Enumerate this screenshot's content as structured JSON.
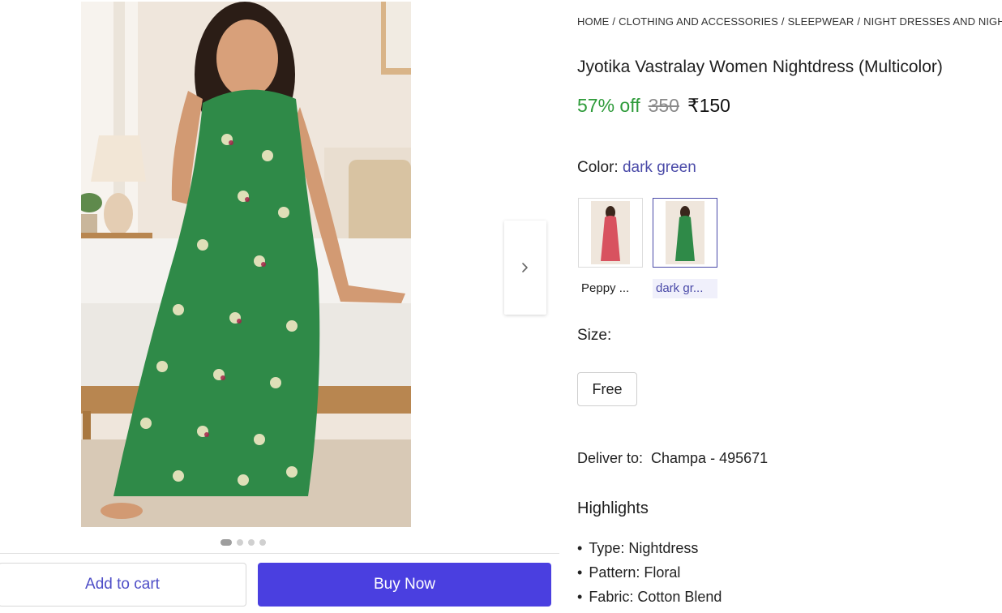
{
  "breadcrumb": [
    "HOME",
    "CLOTHING AND ACCESSORIES",
    "SLEEPWEAR",
    "NIGHT DRESSES AND NIGHTIES"
  ],
  "product": {
    "title": "Jyotika Vastralay Women Nightdress (Multicolor)",
    "discount": "57% off",
    "mrp": "350",
    "price": "₹150"
  },
  "color": {
    "label": "Color:",
    "selected": "dark green",
    "options": [
      {
        "label": "Peppy ...",
        "swatch": "#d8525f"
      },
      {
        "label": "dark gr...",
        "swatch": "#2f8a48"
      }
    ]
  },
  "size": {
    "label": "Size:",
    "options": [
      "Free"
    ]
  },
  "delivery": {
    "label": "Deliver to:",
    "location": "Champa - 495671"
  },
  "highlights": {
    "title": "Highlights",
    "items": [
      "Type: Nightdress",
      "Pattern: Floral",
      "Fabric: Cotton Blend"
    ]
  },
  "gallery": {
    "dots": 4,
    "active_dot": 1,
    "next_icon": "chevron-right-icon"
  },
  "actions": {
    "add_to_cart": "Add to cart",
    "buy_now": "Buy Now"
  },
  "colors": {
    "accent": "#4a3fe0",
    "discount": "#2e9b3a",
    "link": "#4a4aa8"
  }
}
